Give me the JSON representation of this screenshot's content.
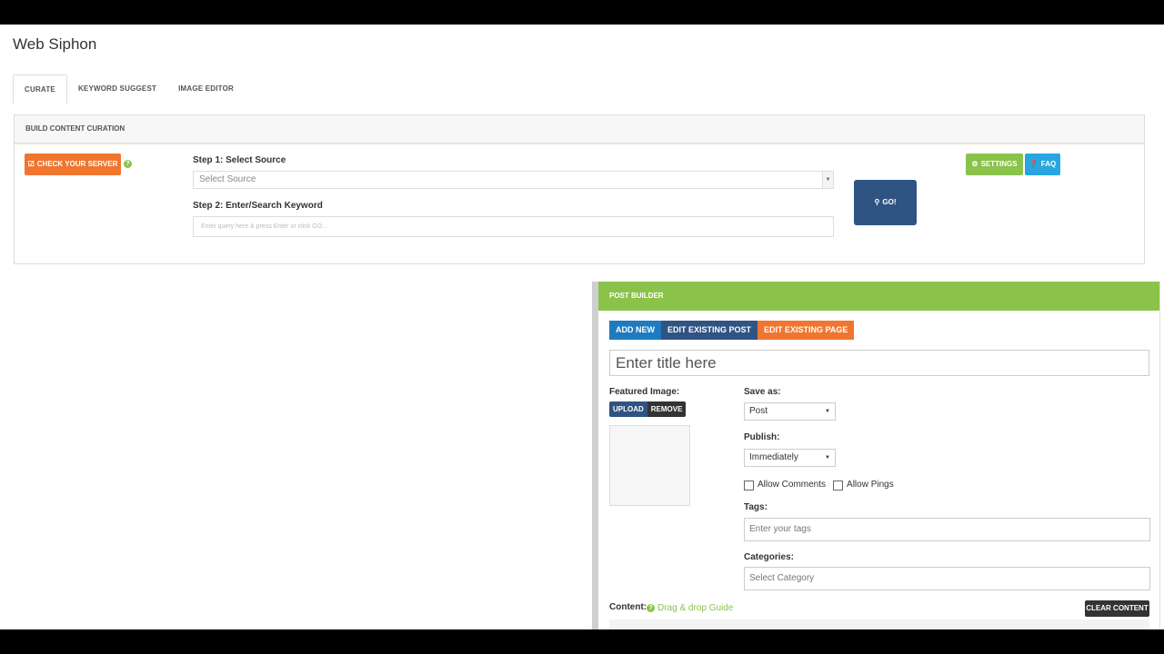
{
  "app": {
    "title": "Web Siphon"
  },
  "tabs": [
    {
      "label": "CURATE",
      "active": true
    },
    {
      "label": "KEYWORD SUGGEST",
      "active": false
    },
    {
      "label": "IMAGE EDITOR",
      "active": false
    }
  ],
  "curation": {
    "heading": "BUILD CONTENT CURATION",
    "check_server_label": "CHECK YOUR SERVER",
    "step1_label": "Step 1: Select Source",
    "source_placeholder": "Select Source",
    "step2_label": "Step 2: Enter/Search Keyword",
    "keyword_placeholder": "Enter query here & press Enter or click GO...",
    "go_label": "GO!",
    "settings_label": "SETTINGS",
    "faq_label": "FAQ"
  },
  "post_builder": {
    "heading": "POST BUILDER",
    "modes": {
      "add_new": "ADD NEW",
      "edit_post": "EDIT EXISTING POST",
      "edit_page": "EDIT EXISTING PAGE"
    },
    "title_placeholder": "Enter title here",
    "featured_image_label": "Featured Image:",
    "upload_label": "UPLOAD",
    "remove_label": "REMOVE",
    "save_as_label": "Save as:",
    "save_as_value": "Post",
    "publish_label": "Publish:",
    "publish_value": "Immediately",
    "allow_comments_label": "Allow Comments",
    "allow_pings_label": "Allow Pings",
    "tags_label": "Tags:",
    "tags_placeholder": "Enter your tags",
    "categories_label": "Categories:",
    "categories_placeholder": "Select Category",
    "content_label": "Content:",
    "guide_label": "Drag & drop Guide",
    "clear_label": "CLEAR CONTENT"
  },
  "colors": {
    "orange": "#f0762f",
    "green": "#8bc34a",
    "navy": "#2f5483",
    "blue": "#1f7bbf",
    "sky": "#29a6e0",
    "dark": "#333333"
  },
  "icons": {
    "check_server": "server-check-icon",
    "help": "question-circle-icon",
    "go": "search-icon",
    "settings": "gear-icon",
    "faq": "question-circle-icon"
  }
}
